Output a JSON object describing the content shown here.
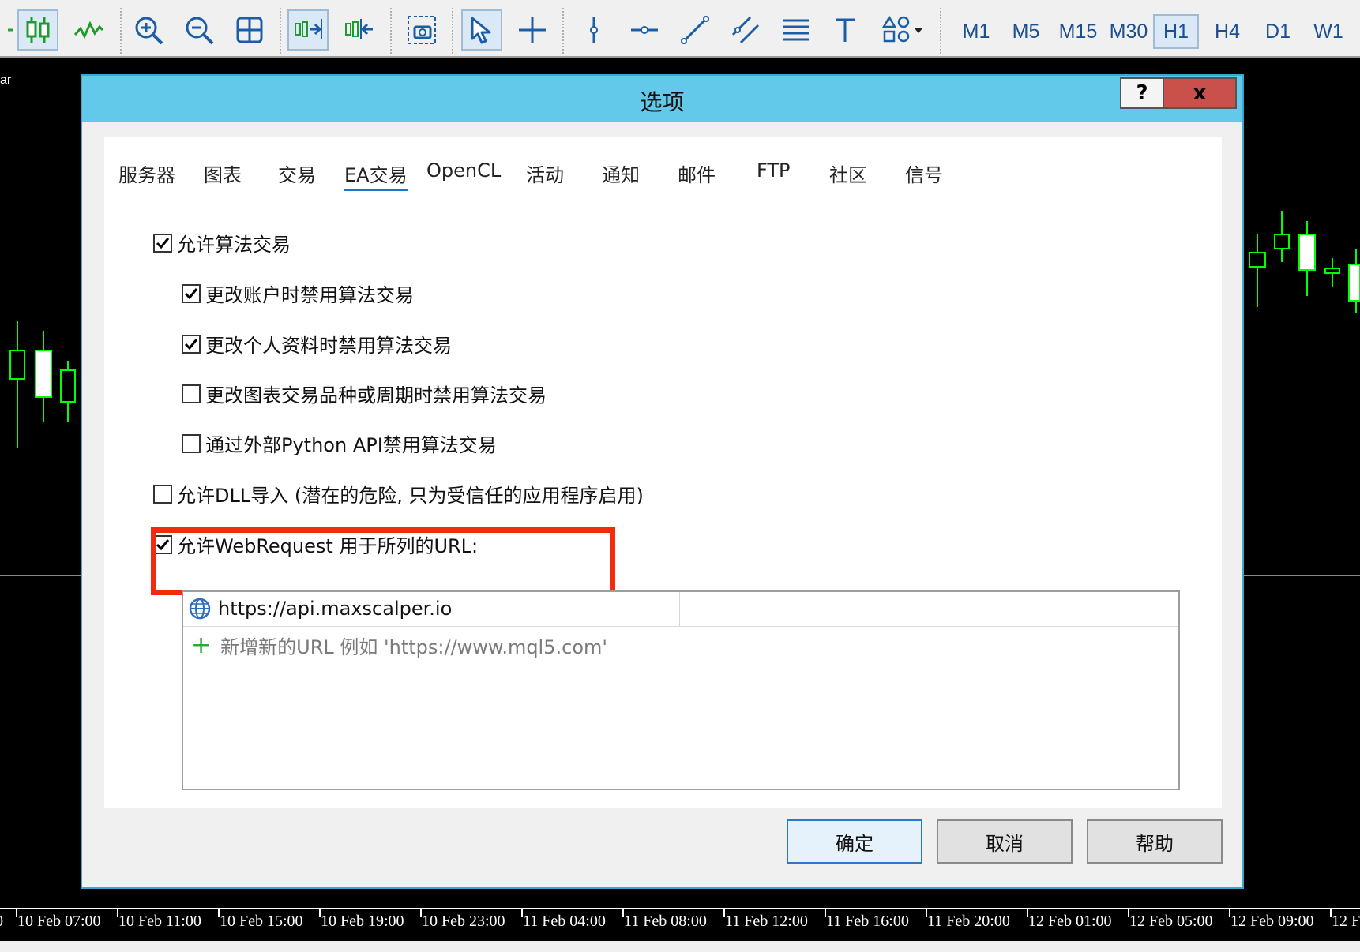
{
  "toolbar": {
    "timeframes": [
      {
        "label": "M1"
      },
      {
        "label": "M5"
      },
      {
        "label": "M15"
      },
      {
        "label": "M30"
      },
      {
        "label": "H1",
        "active": true
      },
      {
        "label": "H4"
      },
      {
        "label": "D1"
      },
      {
        "label": "W1"
      }
    ]
  },
  "chart": {
    "corner_label": "ar",
    "x_ticks": [
      "10 Feb 07:00",
      "10 Feb 11:00",
      "10 Feb 15:00",
      "10 Feb 19:00",
      "10 Feb 23:00",
      "11 Feb 04:00",
      "11 Feb 08:00",
      "11 Feb 12:00",
      "11 Feb 16:00",
      "11 Feb 20:00",
      "12 Feb 01:00",
      "12 Feb 05:00",
      "12 Feb 09:00",
      "12 F"
    ],
    "x_axis_left_fragment": "0",
    "colors": {
      "bull": "#00ff00",
      "bear": "#ffffff",
      "background": "#000000"
    }
  },
  "dialog": {
    "title": "选项",
    "help_label": "?",
    "close_label": "x",
    "tabs": [
      "服务器",
      "图表",
      "交易",
      "EA交易",
      "OpenCL",
      "活动",
      "通知",
      "邮件",
      "FTP",
      "社区",
      "信号"
    ],
    "selected_tab": "EA交易",
    "options": [
      {
        "label": "允许算法交易",
        "checked": true
      },
      {
        "label": "更改账户时禁用算法交易",
        "checked": true
      },
      {
        "label": "更改个人资料时禁用算法交易",
        "checked": true
      },
      {
        "label": "更改图表交易品种或周期时禁用算法交易",
        "checked": false
      },
      {
        "label": "通过外部Python API禁用算法交易",
        "checked": false
      },
      {
        "label": "允许DLL导入 (潜在的危险, 只为受信任的应用程序启用)",
        "checked": false
      },
      {
        "label": "允许WebRequest 用于所列的URL:",
        "checked": true
      }
    ],
    "url_list": {
      "urls": [
        "https://api.maxscalper.io"
      ],
      "add_hint": "新增新的URL 例如 'https://www.mql5.com'"
    },
    "buttons": {
      "ok": "确定",
      "cancel": "取消",
      "help": "帮助"
    },
    "highlight_color": "#f42a0c",
    "title_bar_color": "#63c9ea"
  }
}
